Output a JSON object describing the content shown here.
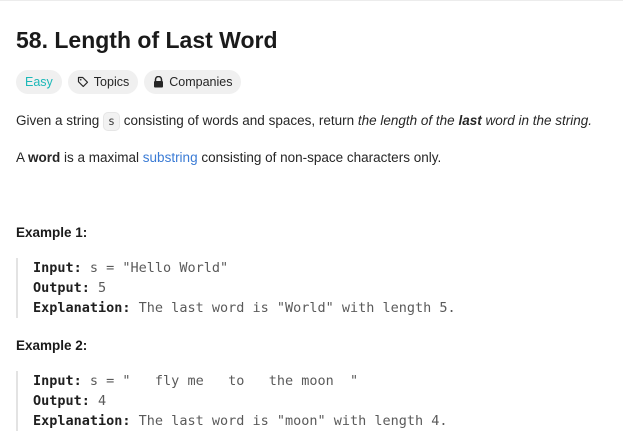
{
  "problem": {
    "title": "58. Length of Last Word",
    "tags": {
      "difficulty": "Easy",
      "topics": "Topics",
      "companies": "Companies"
    },
    "statement": {
      "p1_before": "Given a string ",
      "p1_code": "s",
      "p1_middle": " consisting of words and spaces, return ",
      "p1_italic1": "the length of the ",
      "p1_bold_italic": "last",
      "p1_italic2": " word in the string."
    },
    "definition": {
      "p2_before": "A ",
      "p2_bold": "word",
      "p2_middle": " is a maximal ",
      "p2_link": "substring",
      "p2_after": " consisting of non-space characters only."
    },
    "examples": [
      {
        "title": "Example 1:",
        "input_label": "Input:",
        "input_value": " s = \"Hello World\"",
        "output_label": "Output:",
        "output_value": " 5",
        "explanation_label": "Explanation:",
        "explanation_value": " The last word is \"World\" with length 5."
      },
      {
        "title": "Example 2:",
        "input_label": "Input:",
        "input_value": " s = \"   fly me   to   the moon  \"",
        "output_label": "Output:",
        "output_value": " 4",
        "explanation_label": "Explanation:",
        "explanation_value": " The last word is \"moon\" with length 4."
      }
    ]
  },
  "colors": {
    "difficulty_easy": "#1cb8b8",
    "link": "#3a7bd5",
    "tag_bg": "#f0f0f0"
  },
  "icons": {
    "topics": "tag-icon",
    "companies": "lock-icon"
  }
}
